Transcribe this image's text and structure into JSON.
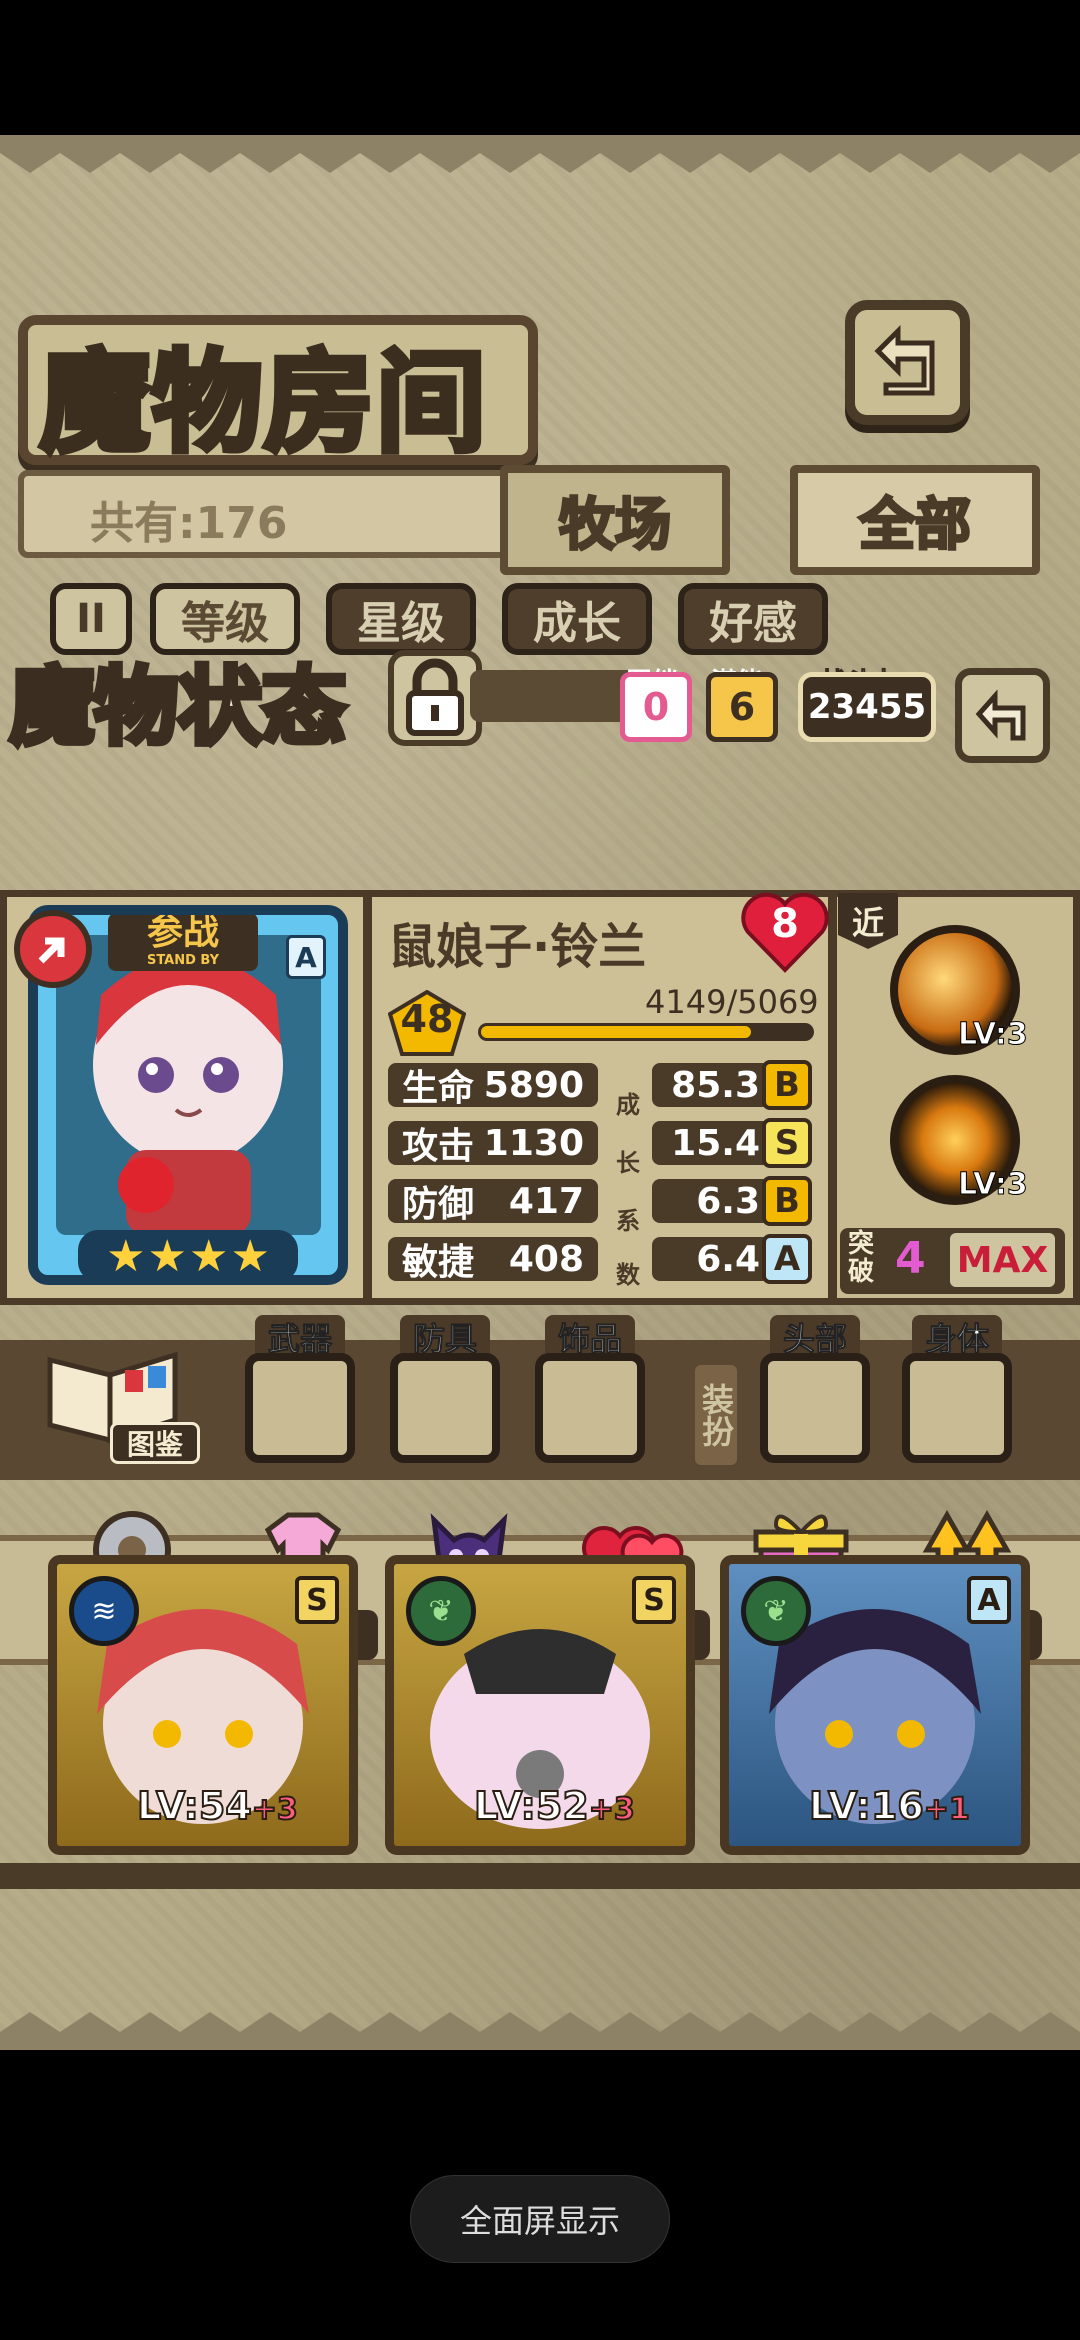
{
  "header": {
    "title": "魔物房间"
  },
  "collection": {
    "count_label": "共有:176"
  },
  "tabs": [
    {
      "label": "牧场"
    },
    {
      "label": "全部"
    }
  ],
  "sort": [
    {
      "label": "等级"
    },
    {
      "label": "星级"
    },
    {
      "label": "成长"
    },
    {
      "label": "好感"
    }
  ],
  "status": {
    "title": "魔物状态",
    "bond_label": "羁绊",
    "bond_value": "0",
    "potential_label": "潜能",
    "potential_value": "6",
    "power_label": "战斗力",
    "power_value": "23455"
  },
  "monster": {
    "standby_label": "参战",
    "standby_sub": "STAND BY",
    "rank": "A",
    "name": "鼠娘子·铃兰",
    "affection": "8",
    "level": "48",
    "xp_text": "4149/5069",
    "xp_fraction": 0.8186,
    "stars": 4,
    "attack_type": "近",
    "stats": [
      {
        "label": "生命",
        "value": "5890",
        "growth": "85.3",
        "grade": "B"
      },
      {
        "label": "攻击",
        "value": "1130",
        "growth": "15.4",
        "grade": "S"
      },
      {
        "label": "防御",
        "value": "417",
        "growth": "6.3",
        "grade": "B"
      },
      {
        "label": "敏捷",
        "value": "408",
        "growth": "6.4",
        "grade": "A"
      }
    ],
    "growth_chars": [
      "成",
      "长",
      "系",
      "数"
    ],
    "skills": [
      {
        "level": "LV:3"
      },
      {
        "level": "LV:3"
      }
    ],
    "breakthrough_label": "突破",
    "breakthrough_value": "4",
    "breakthrough_max": "MAX"
  },
  "equipment": {
    "book_label": "图鉴",
    "dress_label": "装扮",
    "slots": [
      {
        "label": "武器"
      },
      {
        "label": "防具"
      },
      {
        "label": "饰品"
      },
      {
        "label": "头部"
      },
      {
        "label": "身体"
      }
    ]
  },
  "actions": [
    {
      "label": "操作",
      "icon": "gear-icon"
    },
    {
      "label": "时装",
      "icon": "outfit-icon"
    },
    {
      "label": "潜能",
      "icon": "demon-icon"
    },
    {
      "label": "羁绊",
      "icon": "hearts-icon"
    },
    {
      "label": "送礼",
      "icon": "gift-icon"
    },
    {
      "label": "强化",
      "icon": "upgrade-arrows-icon"
    }
  ],
  "cards": [
    {
      "level": "LV:54",
      "plus": "+3",
      "rank": "S",
      "element": "fire-element-icon",
      "color": "#e87d6f"
    },
    {
      "level": "LV:52",
      "plus": "+3",
      "rank": "S",
      "element": "leaf-element-icon",
      "color": "#f3d9ea"
    },
    {
      "level": "LV:16",
      "plus": "+1",
      "rank": "A",
      "element": "leaf-element-icon",
      "color": "#6f88b5"
    }
  ],
  "system": {
    "fullscreen_label": "全面屏显示"
  }
}
